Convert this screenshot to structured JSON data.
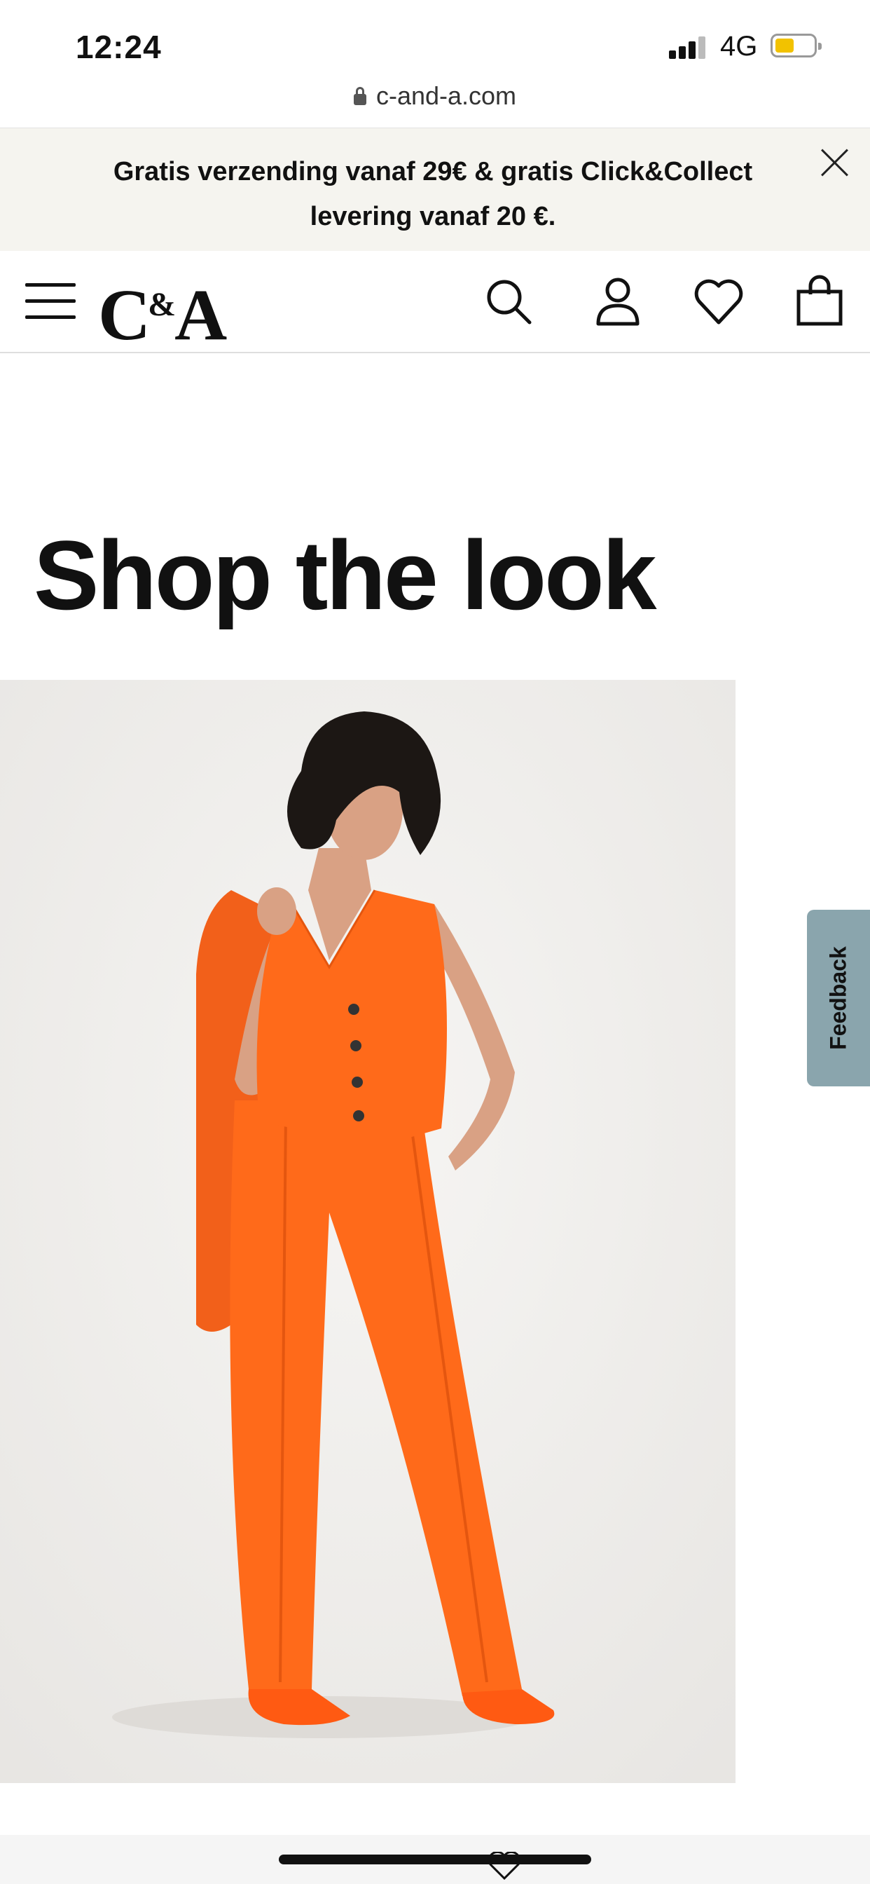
{
  "status_bar": {
    "time": "12:24",
    "network": "4G"
  },
  "browser": {
    "url": "c-and-a.com"
  },
  "banner": {
    "line1": "Gratis verzending vanaf 29€ & gratis Click&Collect",
    "line2": "levering vanaf 20 €."
  },
  "header": {
    "logo_c": "C",
    "logo_amp": "&",
    "logo_a": "A",
    "icons": [
      "menu-icon",
      "search-icon",
      "account-icon",
      "wishlist-heart-icon",
      "shopping-bag-icon"
    ]
  },
  "page": {
    "title": "Shop the look"
  },
  "feedback": {
    "label": "Feedback"
  },
  "colors": {
    "banner_bg": "#f5f4ef",
    "feedback_bg": "#8aa5ad",
    "suit_orange": "#ff6a1a",
    "battery": "#f2c200"
  }
}
